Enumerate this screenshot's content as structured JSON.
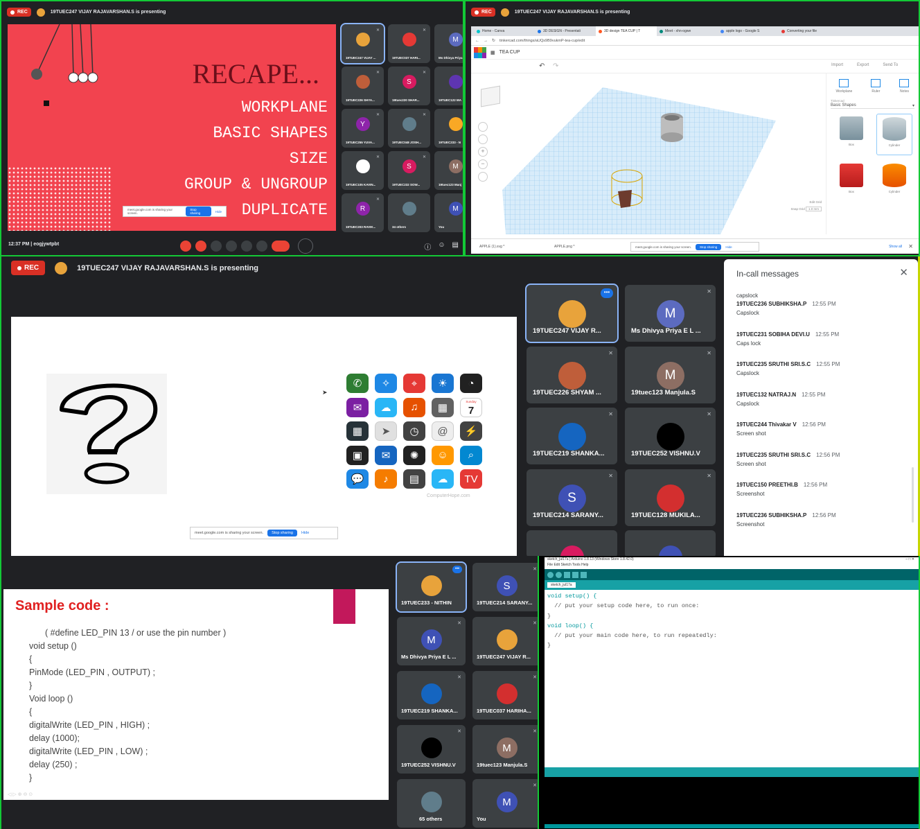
{
  "q1": {
    "rec": "REC",
    "presenter": "19TUEC247 VIJAY RAJAVARSHAN.S is presenting",
    "slide": {
      "title": "RECAPE...",
      "items": [
        "WORKPLANE",
        "BASIC SHAPES",
        "SIZE",
        "GROUP & UNGROUP",
        "DUPLICATE"
      ]
    },
    "share_bar": {
      "text": "meet.google.com is sharing your screen.",
      "stop": "Stop sharing",
      "hide": "Hide"
    },
    "tiles": [
      "19TUEC247 VIJAY ...",
      "19TUEC037 HARI...",
      "Ms Dhivya Priya",
      "19TUEC226 SHYA...",
      "19tuec220 SHAR...",
      "19TUEC122 MA",
      "19TUEC255 YUVA...",
      "19TUEC048 JOSH...",
      "19TUEC233 - N",
      "19TUEC105 KAVIN...",
      "19TUEC232 SOW...",
      "19tuec123 Manj",
      "19TUEC203 RAVIK...",
      "34 others",
      "You"
    ],
    "initials": {
      "t2": "M",
      "t4": "S",
      "t6": "Y",
      "t10": "S",
      "t11": "M",
      "t12": "R",
      "t14": "M"
    },
    "time": "12:37 PM",
    "code": "eogjywtpbt"
  },
  "q2": {
    "rec": "REC",
    "presenter": "19TUEC247 VIJAY RAJAVARSHAN.S is presenting",
    "tabs": [
      "Home - Canva",
      "3D DESIGN - Presentati",
      "3D design TEA CUP | T",
      "Meet - xhn-ogwe",
      "apple logo - Google S",
      "Converting your file"
    ],
    "url": "tinkercad.com/things/aUQs9B9vukmP-tea-cup/edit",
    "design": "TEA CUP",
    "toolbar": [
      "Import",
      "Export",
      "Send To"
    ],
    "panel": {
      "tools": [
        "Workplane",
        "Ruler",
        "Notes"
      ],
      "lib_label": "Tinkercad",
      "lib": "Basic Shapes",
      "shapes": [
        "Box",
        "Cylinder",
        "Box",
        "Cylinder"
      ]
    },
    "edit_grid": "Edit Grid",
    "snap_grid": "Snap Grid",
    "snap_val": "1.0 mm",
    "downloads": [
      "APPLE (1).svg",
      "APPLE.png"
    ],
    "show_all": "Show all",
    "share_bar": {
      "text": "meet.google.com is sharing your screen.",
      "stop": "Stop sharing",
      "hide": "Hide"
    }
  },
  "q3": {
    "rec": "REC",
    "presenter": "19TUEC247 VIJAY RAJAVARSHAN.S is presenting",
    "watermark": "ComputerHope.com",
    "share_bar": {
      "text": "meet.google.com is sharing your screen.",
      "stop": "Stop sharing",
      "hide": "Hide"
    },
    "tiles": [
      "19TUEC247 VIJAY R...",
      "Ms Dhivya Priya E L ...",
      "19TUEC226 SHYAM ...",
      "19tuec123 Manjula.S",
      "19TUEC219 SHANKA...",
      "19TUEC252 VISHNU.V",
      "19TUEC214 SARANY...",
      "19TUEC128 MUKILA..."
    ],
    "initials": {
      "t1": "M",
      "t3": "M",
      "t6": "S"
    },
    "calendar": {
      "day": "Sunday",
      "date": "7"
    },
    "chat": {
      "title": "In-call messages",
      "messages": [
        {
          "sender": "19TUEC236 SUBHIKSHA.P",
          "time": "12:55 PM",
          "text": "Capslock"
        },
        {
          "sender": "19TUEC231 SOBIHA DEVI.U",
          "time": "12:55 PM",
          "text": "Caps lock"
        },
        {
          "sender": "19TUEC235 SRUTHI SRI.S.C",
          "time": "12:55 PM",
          "text": "Capslock"
        },
        {
          "sender": "19TUEC132 NATRAJ.N",
          "time": "12:55 PM",
          "text": "Capslock"
        },
        {
          "sender": "19TUEC244 Thivakar V",
          "time": "12:56 PM",
          "text": "Screen shot"
        },
        {
          "sender": "19TUEC235 SRUTHI SRI.S.C",
          "time": "12:56 PM",
          "text": "Screen shot"
        },
        {
          "sender": "19TUEC150 PREETHI.B",
          "time": "12:56 PM",
          "text": "Screenshot"
        },
        {
          "sender": "19TUEC236 SUBHIKSHA.P",
          "time": "12:56 PM",
          "text": "Screenshot"
        }
      ],
      "first_text": "capslock"
    }
  },
  "q4": {
    "slide": {
      "title": "Sample code :",
      "lines": [
        "( #define LED_PIN 13 / or use the pin number )",
        "void setup ()",
        "{",
        "PinMode (LED_PIN , OUTPUT) ;",
        "}",
        "Void loop ()",
        "{",
        "digitalWrite (LED_PIN , HIGH) ;",
        "delay (1000);",
        "digitalWrite (LED_PIN , LOW) ;",
        "delay (250) ;",
        "}"
      ]
    },
    "tiles": [
      "19TUEC233 - NITHIN",
      "19TUEC214 SARANY...",
      "Ms Dhivya Priya E L ...",
      "19TUEC247 VIJAY R...",
      "19TUEC219 SHANKA...",
      "19TUEC037 HARIHA...",
      "19TUEC252 VISHNU.V",
      "19tuec123 Manjula.S",
      "65 others",
      "You"
    ],
    "initials": {
      "t1": "S",
      "t2": "M",
      "t7": "M",
      "t9": "M"
    },
    "arduino": {
      "title": "sketch_jul17a | Arduino 1.8.13 (Windows Store 1.8.42.0)",
      "menu": "File Edit Sketch Tools Help",
      "tab": "sketch_jul17a",
      "code": [
        "void setup() {",
        "  // put your setup code here, to run once:",
        "",
        "}",
        "",
        "void loop() {",
        "  // put your main code here, to run repeatedly:",
        "",
        "}"
      ]
    }
  },
  "colors": {
    "accent": "#8ab4f8",
    "rec": "#d93025",
    "slide_red": "#f2434f",
    "slide_dark": "#6b0f1a",
    "arduino_teal": "#00979c"
  }
}
